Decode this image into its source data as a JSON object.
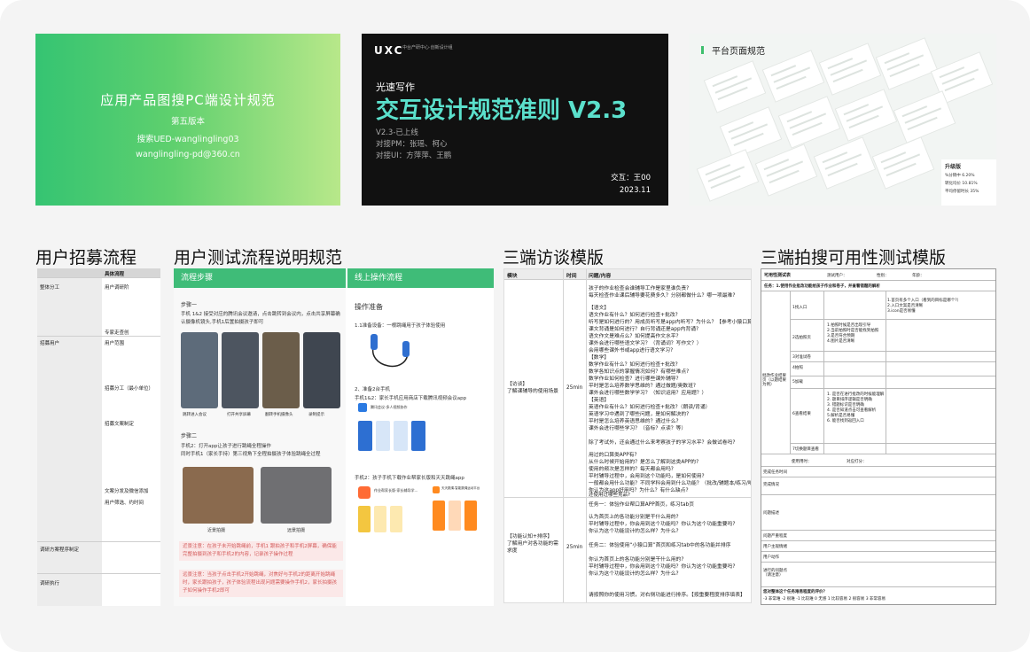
{
  "cards": {
    "c1": {
      "title": "应用产品图搜PC端设计规范",
      "version": "第五版本",
      "author": "搜索UED-wanglingling03",
      "email": "wanglingling-pd@360.cn"
    },
    "c2": {
      "logo": "UXC",
      "logo_sub": "中台产研中心·创新设计组",
      "kicker": "光速写作",
      "title": "交互设计规范准则 V2.3",
      "meta": [
        "V2.3-已上线",
        "对接PM：张瑶、柯心",
        "对接UI：方萍萍、王鹏"
      ],
      "footer_author": "交互：王00",
      "footer_date": "2023.11"
    },
    "c3": {
      "title": "平台页面规范",
      "panel_title": "升级版",
      "panel_lines": [
        "%分销中 6.20%",
        "转化均价 10.81%",
        "平均停留时长 35%"
      ]
    }
  },
  "headings": {
    "h1": "用户招募流程",
    "h2": "用户测试流程说明规范",
    "h3": "三端访谈模版",
    "h4": "三端拍搜可用性测试模版"
  },
  "doc1": {
    "col_header": "具体流程",
    "rows": [
      {
        "left": "整体分工",
        "right": "用户调研阶"
      },
      {
        "left": "",
        "right": "专家走查创"
      },
      {
        "left": "招募用户",
        "right": "用户范围"
      },
      {
        "left": "",
        "right": "招募分工（最小单位）"
      },
      {
        "left": "",
        "right": "招募文案制定"
      },
      {
        "left": "",
        "right": "文案分发及微信添加"
      },
      {
        "left": "",
        "right": "用户筛选、约时间"
      },
      {
        "left": "调研方案程序制定",
        "right": ""
      },
      {
        "left": "调研执行",
        "right": ""
      }
    ]
  },
  "doc2": {
    "left_header": "流程步骤",
    "right_header": "线上操作流程",
    "step1": "步骤一",
    "step1_text": "手机 1&2 接受对应的腾讯会议邀请，点击跳转到会议内，点击共享屏幕确认摄像机镜头,手机1后置拍摄孩子即可",
    "shot_captions": [
      "跳转进入会议",
      "打开共享屏幕",
      "翻转手机摄像头",
      "录制提示"
    ],
    "step2": "步骤二",
    "step2_text": "手机2：打开app让孩子进行跳绳全程操作\n同时手机1（家长手持）第三视角下全程拍摄孩子体验跳绳全过程",
    "photo_captions": [
      "近景拍摄",
      "远景拍摄"
    ],
    "note1": "近景注意：在孩子未开始跳绳前，手机1 跟拍孩子和手机2屏幕，确保能完整拍摄到孩子和手机2的内容，记录孩子操作过程",
    "note2": "远景注意：当孩子点击手机2开始跳绳，对焦好与手机2的距离开始跳绳时，家长跟拍孩子，孩子体验流程出现问题需要操作手机2，家长拍摄孩子如何操作手机2即可",
    "prep_title": "操作准备",
    "prep1": "1.1准备设备：一根跳绳用于孩子体验使用",
    "prep2": "2、准备2台手机",
    "prep2_text": "手机1&2：家长手机应用商店下载腾讯视频会议app",
    "prep3": "手机2：孩子手机下载作业帮家长版和天天跳绳app",
    "app1_name": "腾讯会议-多人视频协作",
    "app2_name": "作业帮家长版-家长辅导学…",
    "app3_name": "天天跳绳-智能跳绳运动平台"
  },
  "doc3": {
    "headers": [
      "模块",
      "时间",
      "问题/内容"
    ],
    "section1_label": "【访谈】\n了解课辅导的使用场景",
    "section1_time": "25min",
    "section1_lines": [
      "孩子的作业检查会谁辅导工作是家里谁负责?",
      "每天检查作业课后辅导要花费多久？分别都做什么？哪一项最难?",
      "",
      "【语文】",
      "语文作业有什么？如何进行检查+批改?",
      "听写是如何进行的？用成员听写是app内听写？为什么？【参考小猿口算】",
      "课文背诵是如何进行？自行背诵还是app内背诵?",
      "语文作文是难点么？如何提高作文水平?",
      "课外会进行哪些语文学习？（背诵词？写作文？）",
      "会用哪些课外书或app进行语文学习?",
      "【数学】",
      "数学作业有什么？如何进行检查+批改?",
      "数学各知识点的掌握情况如何？有哪些难点?",
      "数学作业如何检查？进行哪些课外辅导?",
      "平时是怎么培养数学思维的？通过做题/奥数班?",
      "课外会进行哪些数学学习？（知识运用？应用题？）",
      "【英语】",
      "英语作业有什么？如何进行检查+批改?（朗读/背诵）",
      "英语学习中遇到了哪些问题，是如何解决的?",
      "平时是怎么培养英语思维的？通过什么?",
      "课外会进行哪些学习？（音标？点读？等）",
      "",
      "除了考试外，还会通过什么来考察孩子的学习水平？会做试卷吗?",
      "",
      "用过的口算类APP有?",
      "从什么时候开始用的？是怎么了解到这类APP的?",
      "使用的频次是怎样的？每天都会用吗?",
      "平时辅导过程中，会用到这个功能吗，是如何使用?",
      "一般都会用什么功能？不同学科会用到什么功能？（批改/辅题本/练习/听写/背诵）",
      "你认为这app好用吗？为什么？有什么缺点?",
      "还使用过哪些竞品?"
    ],
    "section2_label": "【功能认知+排序】\n了解用户对各功能的需求度",
    "section2_time": "25min",
    "section2_lines": [
      "任务一：体验作业帮口算APP首页，练习tab页",
      "",
      "认为首页上的各功能分别是干什么用的?",
      "平时辅导过程中，你会用到这个功能吗？你认为这个功能重要吗?",
      "你认为这个功能设计的怎么样？为什么?",
      "",
      "任务二：体验使用“小猿口算”首页和练习tab中的各功能并排序",
      "",
      "你认为首页上的各功能分别是干什么用的?",
      "平时辅导过程中，你会用到这个功能吗？你认为这个功能重要吗?",
      "你认为这个功能设计的怎么样？为什么?",
      "",
      "请按照你的使用习惯，对右侧功能进行排序。【按重要程度排序填表】"
    ]
  },
  "doc4": {
    "title": "可用性测试表",
    "field_labels": [
      "测试用户：",
      "性别：",
      "年龄："
    ],
    "task1": "任务：1.使用作业批改功能给孩子作业和卷子，并查看错题的解析",
    "rows": [
      "1找入口",
      "2选拍照页",
      "3对准试卷",
      "4拍照",
      "5加载",
      "6查看结果",
      "7切换题目查看",
      "8批改错题"
    ],
    "section_left": "批改作业结果页（以题结果为例）",
    "notes1": [
      "1.首页有多个入口（看到的目标是哪个?）",
      "2.入口文案是否清晰",
      "3.icon是否易懂"
    ],
    "notes2": [
      "1.拍照时候是否出现引导",
      "2.当前拍照时是否能找到拍照",
      "3.是否符合预期",
      "4.图片是否清晰"
    ],
    "notes6": [
      "1. 是否在进行批改的时候能理解",
      "2. 题目排序逻辑是否明确",
      "3. 错题标识是否明确",
      "4. 是否知道点击可查看解析",
      "5.解析是否易懂",
      "6. 能否找到返回入口"
    ],
    "bottom_labels": [
      "使用用时：",
      "对应打分：",
      "完成任务时间",
      "完成情况",
      "问题描述",
      "使用建议",
      "问题严重程度",
      "用户主观情绪",
      "用户动作",
      "进行的问题点（请注意）"
    ],
    "scale_title": "您对整体这个任务难易程度的评价？",
    "scale": "-3 非常难 -2 很难 -1 比较难 0 无感 1 比较容易 2 很容易 3 非常容易"
  }
}
